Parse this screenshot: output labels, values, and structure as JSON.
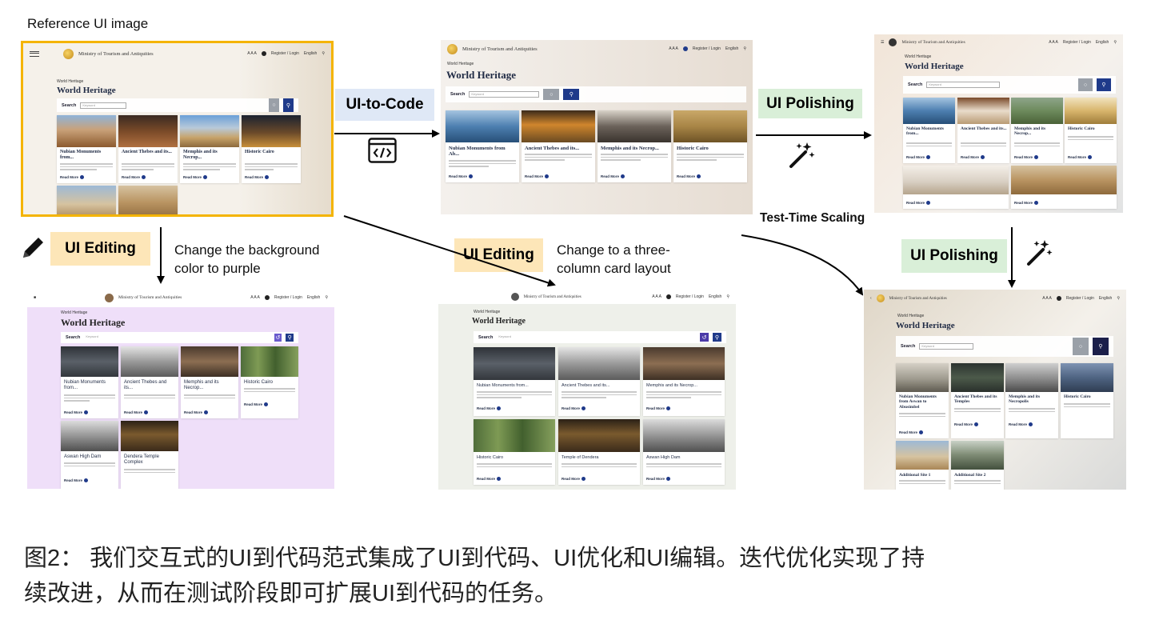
{
  "labels": {
    "reference": "Reference UI image",
    "ui_to_code": "UI-to-Code",
    "ui_polishing": "UI Polishing",
    "ui_editing": "UI Editing",
    "test_time_scaling": "Test-Time Scaling",
    "edit_purple_line1": "Change the background",
    "edit_purple_line2": "color to purple",
    "edit_three_line1": "Change to a three-",
    "edit_three_line2": "column card layout"
  },
  "caption": {
    "line1": "图2： 我们交互式的UI到代码范式集成了UI到代码、UI优化和UI编辑。迭代优化实现了持",
    "line2": "续改进，从而在测试阶段即可扩展UI到代码的任务。"
  },
  "mockup": {
    "ministry": "Ministry of Tourism and Antiquities",
    "breadcrumb": "World Heritage",
    "heading": "World Heritage",
    "search_label": "Search",
    "search_placeholder": "Keyword",
    "nav_text": "A A A",
    "nav_links": "Register / Login",
    "language": "English",
    "read_more": "Read More",
    "cards": {
      "ref": [
        "Nubian Monuments from...",
        "Ancient Thebes and its...",
        "Memphis and its Necrop...",
        "Historic Cairo"
      ],
      "code": [
        "Nubian Monuments from Ab...",
        "Ancient Thebes and its...",
        "Memphis and its Necrop...",
        "Historic Cairo"
      ],
      "polish1": [
        "Nubian Monuments from...",
        "Ancient Thebes and its...",
        "Memphis and its Necrop...",
        "Historic Cairo"
      ],
      "purple": [
        "Nubian Monuments from...",
        "Ancient Thebes and its...",
        "Memphis and its Necrop...",
        "Historic Cairo",
        "Aswan High Dam",
        "Dendera Temple Complex"
      ],
      "three": [
        "Nubian Monuments from...",
        "Ancient Thebes and its...",
        "Memphis and its Necrop...",
        "Historic Cairo",
        "Temple of Dendera",
        "Aswan High Dam"
      ],
      "polish2": [
        "Nubian Monuments from Aswan to Abusimbel",
        "Ancient Thebes and its Temples",
        "Memphis and its Necropolis",
        "Historic Cairo",
        "Additional Site 1",
        "Additional Site 2"
      ]
    }
  },
  "colors": {
    "reference_border": "#f4b400",
    "ui_to_code_bg": "#dfe8f6",
    "ui_polishing_bg": "#d9efd8",
    "ui_editing_bg": "#fde6b8",
    "purple_panel_bg": "#efdff9",
    "button_navy": "#1f3a8a"
  },
  "icons": [
    "code-window-icon",
    "magic-wand-icon",
    "pencil-icon",
    "hamburger-menu-icon",
    "search-icon"
  ]
}
